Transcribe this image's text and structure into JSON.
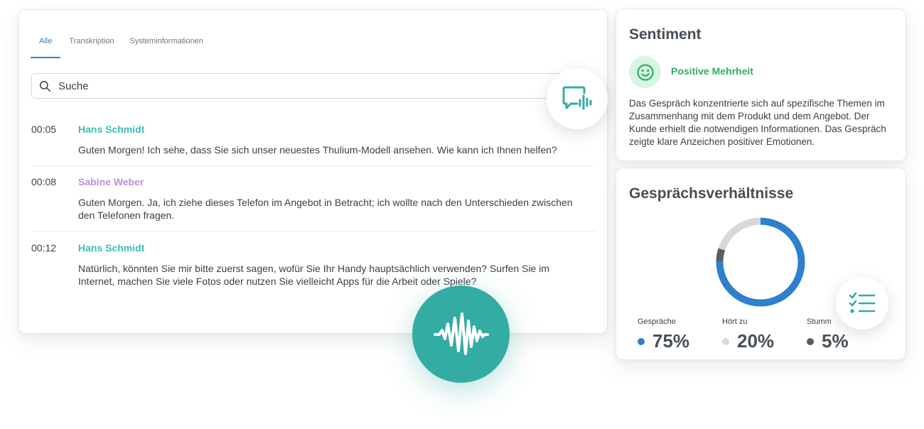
{
  "tabs": [
    {
      "label": "Alle",
      "active": true
    },
    {
      "label": "Transkription",
      "active": false
    },
    {
      "label": "Systeminformationen",
      "active": false
    }
  ],
  "search": {
    "placeholder": "Suche"
  },
  "messages": [
    {
      "time": "00:05",
      "speaker": "Hans Schmidt",
      "speaker_color": "#3fbcb6",
      "text": "Guten Morgen! Ich sehe, dass Sie sich unser neuestes Thulium-Modell ansehen. Wie kann ich Ihnen helfen?"
    },
    {
      "time": "00:08",
      "speaker": "Sabine Weber",
      "speaker_color": "#b592dd",
      "text": "Guten Morgen. Ja, ich ziehe dieses Telefon im Angebot in Betracht; ich wollte nach den Unterschieden zwischen den Telefonen fragen."
    },
    {
      "time": "00:12",
      "speaker": "Hans Schmidt",
      "speaker_color": "#3fbcb6",
      "text": "Natürlich, könnten Sie mir bitte zuerst sagen, wofür Sie Ihr Handy hauptsächlich verwenden? Surfen Sie im Internet, machen Sie viele Fotos oder nutzen Sie vielleicht Apps für die Arbeit oder Spiele?"
    }
  ],
  "sentiment": {
    "title": "Sentiment",
    "label": "Positive Mehrheit",
    "description": "Das Gespräch konzentrierte sich auf spezifische Themen im Zusammenhang mit dem Produkt und dem Angebot. Der Kunde erhielt die notwendigen Informationen. Das Gespräch zeigte klare Anzeichen positiver Emotionen."
  },
  "ratios": {
    "title": "Gesprächsverhältnisse",
    "items": [
      {
        "label": "Gespräche",
        "value": "75%",
        "fraction": 0.75,
        "color": "#2f7fcf"
      },
      {
        "label": "Hört zu",
        "value": "20%",
        "fraction": 0.2,
        "color": "#d6d8db"
      },
      {
        "label": "Stumm",
        "value": "5%",
        "fraction": 0.05,
        "color": "#595e63"
      }
    ]
  },
  "icons": {
    "search": "search-icon",
    "chat": "speech-bubble-audio-icon",
    "list": "checklist-icon",
    "wave": "sound-wave-icon",
    "smile": "smiley-face-icon"
  }
}
